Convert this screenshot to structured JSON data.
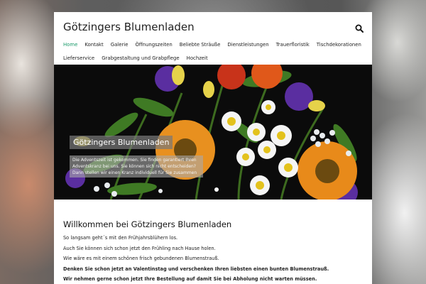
{
  "site": {
    "title": "Götzingers Blumenladen"
  },
  "nav": {
    "rows": [
      [
        "Home",
        "Kontakt",
        "Galerie",
        "Öffnungszeiten",
        "Beliebte Sträuße",
        "Dienstleistungen",
        "Trauerfloristik",
        "Tischdekorationen"
      ],
      [
        "Lieferservice",
        "Grabgestaltung und Grabpflege",
        "Hochzeit"
      ]
    ],
    "active": "Home"
  },
  "hero": {
    "caption_title": "Götzingers Blumenladen",
    "caption_text": "Die Adventszeit ist gekommen. Sie finden garantiert Ihren Adventskranz bei uns. Sie können sich nicht entscheiden? Dann stellen wir einen Kranz individuell für Sie zusammen"
  },
  "content": {
    "heading": "Willkommen bei Götzingers Blumenladen",
    "paragraphs": [
      {
        "text": "So langsam geht´s mit den Frühjahrsblühern los.",
        "bold": false
      },
      {
        "text": "Auch Sie können sich schon jetzt den Frühling nach Hause holen.",
        "bold": false
      },
      {
        "text": "Wie wäre es mit einem schönen frisch gebundenen Blumenstrauß.",
        "bold": false
      },
      {
        "text": "Denken Sie schon jetzt an Valentinstag und verschenken Ihren liebsten einen bunten Blumenstrauß.",
        "bold": true
      },
      {
        "text": "Wir nehmen gerne schon jetzt Ihre Bestellung auf damit Sie bei Abholung nicht warten müssen.",
        "bold": true
      }
    ]
  },
  "icons": {
    "search": "search-icon"
  },
  "colors": {
    "accent": "#1a9a6a",
    "text": "#222222"
  }
}
